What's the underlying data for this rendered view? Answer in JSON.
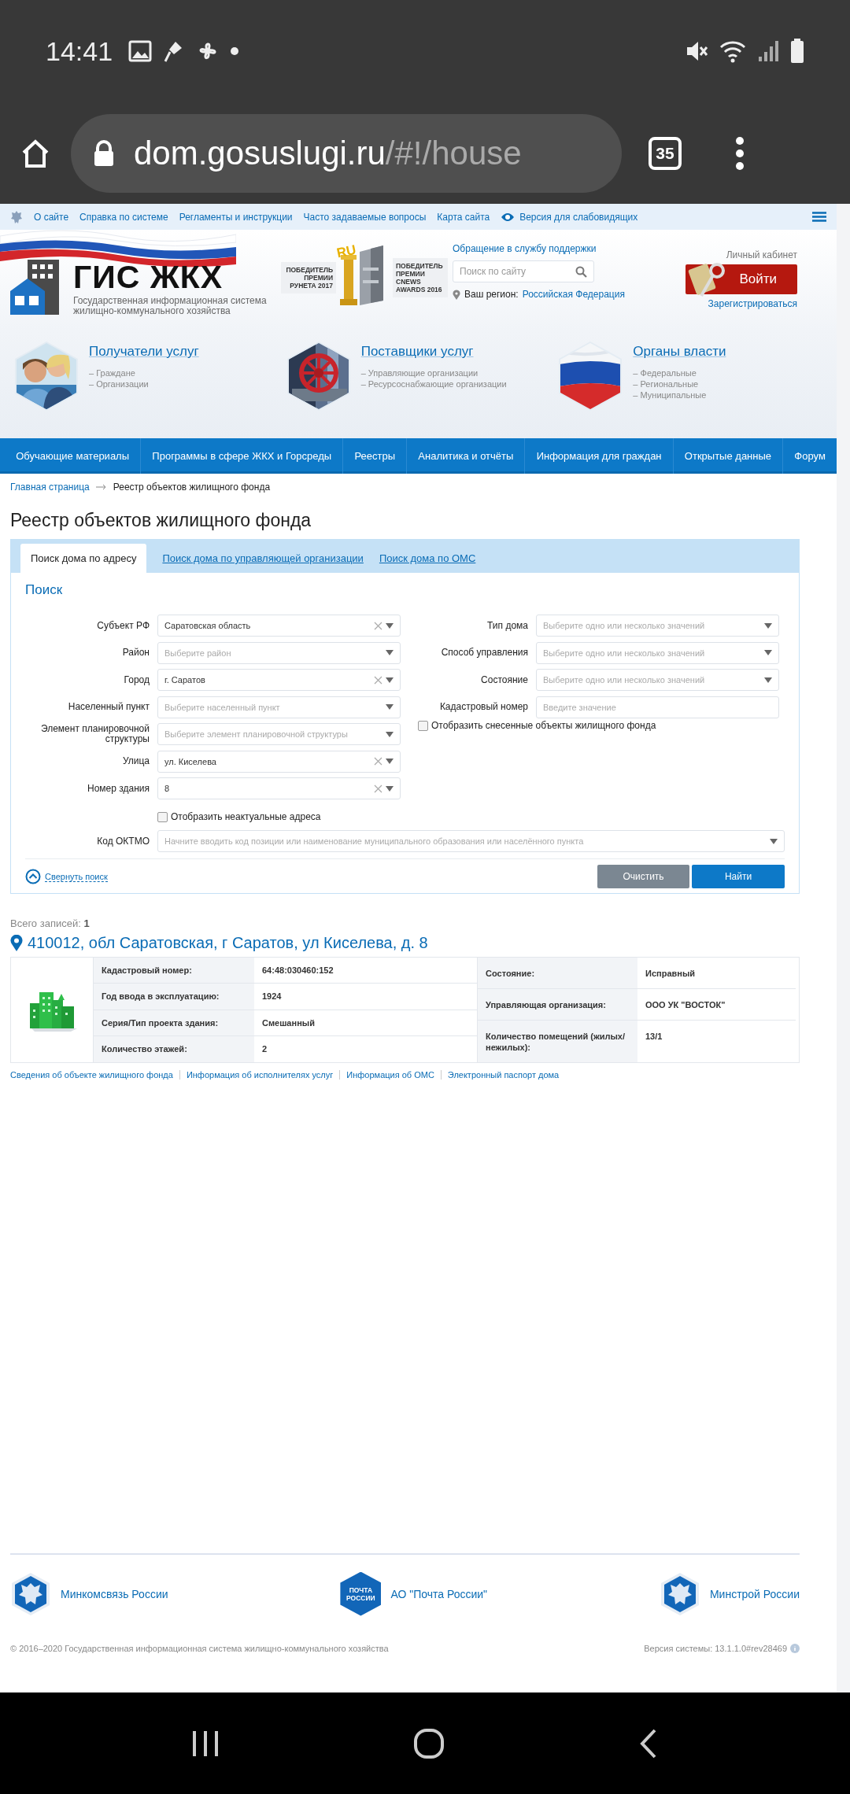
{
  "status_bar": {
    "time": "14:41"
  },
  "browser": {
    "host": "dom.gosuslugi.ru",
    "path": "/#!/house",
    "tab_count": "35"
  },
  "top_links": [
    {
      "label": "О сайте",
      "kind": "link"
    },
    {
      "label": "Справка по системе",
      "kind": "link"
    },
    {
      "label": "Регламенты и инструкции",
      "kind": "link"
    },
    {
      "label": "Часто задаваемые вопросы",
      "kind": "link"
    },
    {
      "label": "Карта сайта",
      "kind": "link"
    },
    {
      "label": "Версия для слабовидящих",
      "kind": "accessibility"
    }
  ],
  "header": {
    "logo_title": "ГИС ЖКХ",
    "logo_subtitle": "Государственная информационная система жилищно-коммунального хозяйства",
    "award_badge": "RU",
    "awards": [
      "ПОБЕДИТЕЛЬ ПРЕМИИ РУНЕТА 2017",
      "ПОБЕДИТЕЛЬ ПРЕМИИ CNEWS AWARDS 2016"
    ],
    "support_link": "Обращение в службу поддержки",
    "search": {
      "placeholder": "Поиск по сайту"
    },
    "region_label": "Ваш регион:",
    "region_value": "Российская Федерация",
    "cabinet_label": "Личный кабинет",
    "login_button": "Войти",
    "register_link": "Зарегистрироваться"
  },
  "categories": [
    {
      "title": "Получатели услуг",
      "kind": "people",
      "items": [
        "– Граждане",
        "– Организации"
      ]
    },
    {
      "title": "Поставщики услуг",
      "kind": "valve",
      "items": [
        "– Управляющие организации",
        "– Ресурсоснабжающие организации"
      ]
    },
    {
      "title": "Органы власти",
      "kind": "flag",
      "items": [
        "– Федеральные",
        "– Региональные",
        "– Муниципальные"
      ]
    }
  ],
  "nav": [
    "Обучающие материалы",
    "Программы в сфере ЖКХ и Горсреды",
    "Реестры",
    "Аналитика и отчёты",
    "Информация для граждан",
    "Открытые данные",
    "Форум"
  ],
  "breadcrumb": [
    "Главная страница",
    "Реестр объектов жилищного фонда"
  ],
  "page_title": "Реестр объектов жилищного фонда",
  "tabs": [
    {
      "label": "Поиск дома по адресу",
      "selected": true
    },
    {
      "label": "Поиск дома по управляющей организации",
      "selected": false
    },
    {
      "label": "Поиск дома по ОМС",
      "selected": false
    }
  ],
  "search_form": {
    "title": "Поиск",
    "left_fields": [
      {
        "label": "Субъект РФ",
        "kind": "select",
        "value": "Саратовская область"
      },
      {
        "label": "Район",
        "kind": "select",
        "placeholder": "Выберите район"
      },
      {
        "label": "Город",
        "kind": "select",
        "value": "г. Саратов"
      },
      {
        "label": "Населенный пункт",
        "kind": "select",
        "placeholder": "Выберите населенный пункт"
      },
      {
        "label": "Элемент планировочной структуры",
        "kind": "select",
        "placeholder": "Выберите элемент планировочной структуры"
      },
      {
        "label": "Улица",
        "kind": "select",
        "value": "ул. Киселева"
      },
      {
        "label": "Номер здания",
        "kind": "select",
        "value": "8"
      }
    ],
    "left_checkbox": {
      "label": "Отобразить неактуальные адреса",
      "checked": false
    },
    "right_fields": [
      {
        "label": "Тип дома",
        "kind": "select",
        "placeholder": "Выберите одно или несколько значений"
      },
      {
        "label": "Способ управления",
        "kind": "select",
        "placeholder": "Выберите одно или несколько значений"
      },
      {
        "label": "Состояние",
        "kind": "select",
        "placeholder": "Выберите одно или несколько значений"
      },
      {
        "label": "Кадастровый номер",
        "kind": "text",
        "placeholder": "Введите значение"
      }
    ],
    "right_checkbox": {
      "label": "Отобразить снесенные объекты жилищного фонда",
      "checked": false
    },
    "oktmo": {
      "label": "Код ОКТМО",
      "kind": "select",
      "placeholder": "Начните вводить код позиции или наименование муниципального образования или населённого пункта"
    },
    "collapse_link": "Свернуть поиск",
    "buttons": [
      {
        "label": "Очистить",
        "kind": "secondary"
      },
      {
        "label": "Найти",
        "kind": "primary"
      }
    ]
  },
  "results": {
    "total_label": "Всего записей:",
    "total": "1",
    "address": "410012, обл Саратовская, г Саратов, ул Киселева, д. 8",
    "left_rows": [
      {
        "label": "Кадастровый номер:",
        "value": "64:48:030460:152"
      },
      {
        "label": "Год ввода в эксплуатацию:",
        "value": "1924"
      },
      {
        "label": "Серия/Тип проекта здания:",
        "value": "Смешанный"
      },
      {
        "label": "Количество этажей:",
        "value": "2"
      }
    ],
    "right_rows": [
      {
        "label": "Состояние:",
        "value": "Исправный"
      },
      {
        "label": "Управляющая организация:",
        "value": "ООО УК \"ВОСТОК\""
      },
      {
        "label": "Количество помещений (жилых/нежилых):",
        "value": "13/1"
      }
    ],
    "links": [
      "Сведения об объекте жилищного фонда",
      "Информация об исполнителях услуг",
      "Информация об ОМС",
      "Электронный паспорт дома"
    ]
  },
  "footer": {
    "partners": [
      {
        "name": "Минкомсвязь России",
        "kind": "emblem"
      },
      {
        "name": "АО \"Почта России\"",
        "kind": "post",
        "logo_text": "ПОЧТА РОССИИ"
      },
      {
        "name": "Минстрой России",
        "kind": "emblem"
      }
    ],
    "copyright": "© 2016–2020 Государственная информационная система жилищно-коммунального хозяйства",
    "version": "Версия системы: 13.1.1.0#rev28469"
  }
}
